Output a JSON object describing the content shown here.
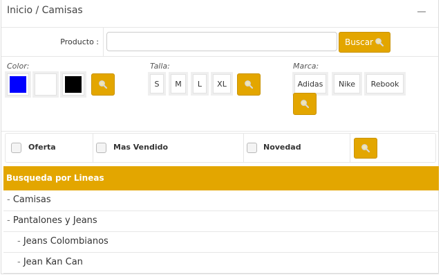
{
  "breadcrumb": {
    "text": "Inicio / Camisas"
  },
  "search": {
    "label": "Producto :",
    "value": "",
    "placeholder": "",
    "button_label": "Buscar"
  },
  "filters": {
    "color": {
      "label": "Color:",
      "swatches": [
        {
          "name": "blue",
          "color": "#0000ff"
        },
        {
          "name": "white",
          "color": "#ffffff"
        },
        {
          "name": "black",
          "color": "#000000"
        }
      ]
    },
    "talla": {
      "label": "Talla:",
      "sizes": [
        "S",
        "M",
        "L",
        "XL"
      ]
    },
    "marca": {
      "label": "Marca:",
      "brands": [
        "Adidas",
        "Nike",
        "Rebook"
      ]
    }
  },
  "checks": {
    "oferta": "Oferta",
    "mas_vendido": "Mas Vendido",
    "novedad": "Novedad"
  },
  "lines": {
    "header": "Busqueda por Lineas",
    "items": [
      "Camisas",
      "Pantalones y Jeans",
      "Jeans Colombianos",
      "Jean Kan Can"
    ]
  },
  "theme": {
    "accent": "#e3a600",
    "icon": "search-icon"
  }
}
